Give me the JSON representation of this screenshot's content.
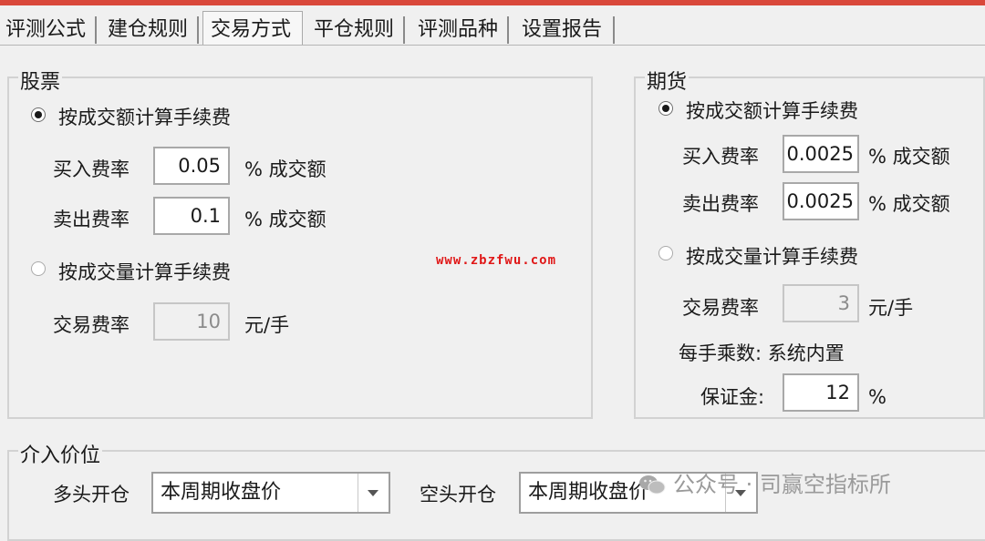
{
  "tabs": [
    "评测公式",
    "建仓规则",
    "交易方式",
    "平仓规则",
    "评测品种",
    "设置报告"
  ],
  "active_tab": "交易方式",
  "stock": {
    "title": "股票",
    "by_amount_label": "按成交额计算手续费",
    "by_amount_checked": true,
    "buy_rate_label": "买入费率",
    "buy_rate_value": "0.05",
    "buy_rate_unit": "% 成交额",
    "sell_rate_label": "卖出费率",
    "sell_rate_value": "0.1",
    "sell_rate_unit": "% 成交额",
    "by_volume_label": "按成交量计算手续费",
    "by_volume_checked": false,
    "trade_rate_label": "交易费率",
    "trade_rate_value": "10",
    "trade_rate_unit": "元/手"
  },
  "futures": {
    "title": "期货",
    "by_amount_label": "按成交额计算手续费",
    "by_amount_checked": true,
    "buy_rate_label": "买入费率",
    "buy_rate_value": "0.0025",
    "buy_rate_unit": "% 成交额",
    "sell_rate_label": "卖出费率",
    "sell_rate_value": "0.0025",
    "sell_rate_unit": "% 成交额",
    "by_volume_label": "按成交量计算手续费",
    "by_volume_checked": false,
    "trade_rate_label": "交易费率",
    "trade_rate_value": "3",
    "trade_rate_unit": "元/手",
    "multiplier_text": "每手乘数: 系统内置",
    "margin_label": "保证金:",
    "margin_value": "12",
    "margin_unit": "%"
  },
  "entry": {
    "title": "介入价位",
    "long_open_label": "多头开仓",
    "long_open_value": "本周期收盘价",
    "short_open_label": "空头开仓",
    "short_open_value": "本周期收盘价"
  },
  "watermark": "www.zbzfwu.com",
  "brand": "公众号 · 司赢空指标所",
  "colors": {
    "title_bar": "#d9483b",
    "watermark": "#e01818"
  }
}
